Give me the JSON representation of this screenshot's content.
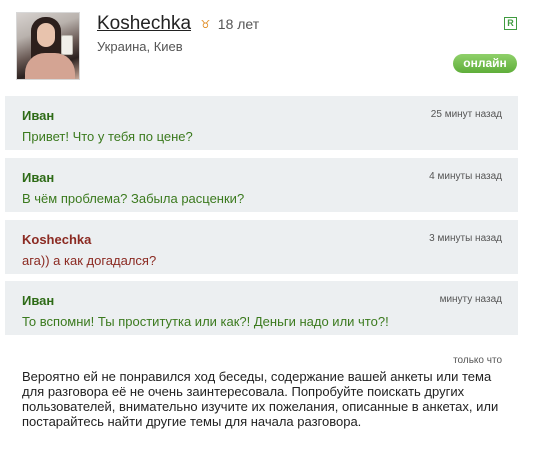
{
  "profile": {
    "username": "Koshechka",
    "zodiac_icon": "zodiac-icon",
    "age": "18 лет",
    "location": "Украина, Киев",
    "r_badge": "R",
    "status": "онлайн"
  },
  "messages": [
    {
      "author": "Иван",
      "time": "25 минут назад",
      "text": "Привет! Что у тебя по цене?"
    },
    {
      "author": "Иван",
      "time": "4 минуты назад",
      "text": "В чём проблема? Забыла расценки?"
    },
    {
      "author": "Koshechka",
      "time": "3 минуты назад",
      "text": "ага)) а как догадался?"
    },
    {
      "author": "Иван",
      "time": "минуту назад",
      "text": "То вспомни! Ты проститутка или как?! Деньги надо или что?!"
    }
  ],
  "system_message": {
    "time": "только что",
    "text": "Вероятно ей не понравился ход беседы, содержание вашей анкеты или тема для разговора её не очень заинтересовала. Попробуйте поискать других пользователей, внимательно изучите их пожелания, описанные в анкетах, или постарайтесь найти другие темы для начала разговора."
  },
  "colors": {
    "message_bg": "#eceff1",
    "male_author": "#2e6b17",
    "female_author": "#8b2a22",
    "online_badge": "#6bbb44"
  }
}
